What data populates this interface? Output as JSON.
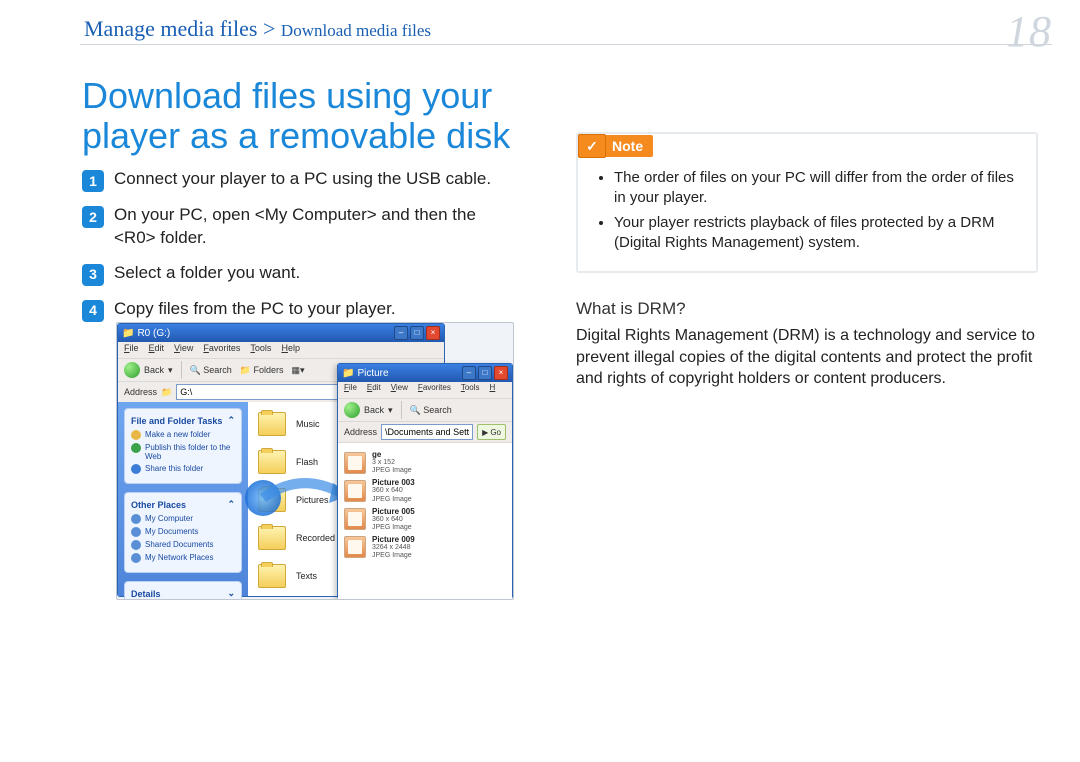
{
  "breadcrumb": {
    "main": "Manage media files",
    "sep": " > ",
    "sub": "Download media files"
  },
  "page_number": "18",
  "title": "Download files using your\nplayer as a removable disk",
  "steps": [
    "Connect your player to a PC using the USB cable.",
    "On your PC, open <My Computer> and then the <R0> folder.",
    "Select a folder you want.",
    "Copy files from the PC to your player."
  ],
  "note": {
    "label": "Note",
    "items": [
      "The order of files on your PC will differ from the order of files in your player.",
      "Your player restricts playback of files protected by a DRM (Digital Rights Management) system."
    ]
  },
  "drm": {
    "heading": "What is DRM?",
    "body": "Digital Rights Management (DRM) is a technology and service to prevent illegal copies of the digital contents and protect the profit and rights of copyright holders or content producers."
  },
  "screenshot": {
    "win1": {
      "title": "R0 (G:)",
      "menu": [
        "File",
        "Edit",
        "View",
        "Favorites",
        "Tools",
        "Help"
      ],
      "toolbar": {
        "back": "Back",
        "search": "Search",
        "folders": "Folders"
      },
      "address_label": "Address",
      "address_value": "G:\\",
      "side": {
        "panel1": {
          "title": "File and Folder Tasks",
          "items": [
            "Make a new folder",
            "Publish this folder to the Web",
            "Share this folder"
          ],
          "dots": [
            "#e8b846",
            "#3aa34a",
            "#3a7cd6"
          ]
        },
        "panel2": {
          "title": "Other Places",
          "items": [
            "My Computer",
            "My Documents",
            "Shared Documents",
            "My Network Places"
          ]
        },
        "panel3": {
          "title": "Details"
        }
      },
      "folders": [
        "Music",
        "Flash",
        "Pictures",
        "Recorded Files",
        "Texts"
      ]
    },
    "win2": {
      "title": "Picture",
      "menu": [
        "File",
        "Edit",
        "View",
        "Favorites",
        "Tools",
        "H"
      ],
      "toolbar": {
        "back": "Back",
        "search": "Search"
      },
      "address_label": "Address",
      "address_value": "\\Documents and Settings\\",
      "go": "Go",
      "items": [
        {
          "name": "ge",
          "dim": "3 x 152",
          "type": "JPEG Image"
        },
        {
          "name": "Picture 003",
          "dim": "360 x 640",
          "type": "JPEG Image"
        },
        {
          "name": "Picture 005",
          "dim": "360 x 640",
          "type": "JPEG Image"
        },
        {
          "name": "Picture 009",
          "dim": "3264 x 2448",
          "type": "JPEG Image"
        }
      ]
    }
  }
}
